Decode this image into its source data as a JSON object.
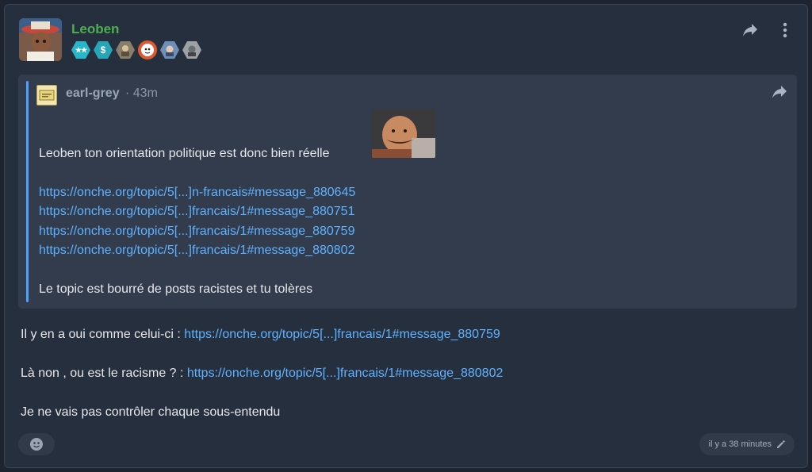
{
  "post": {
    "author": "Leoben",
    "author_color": "#4caf50",
    "badges": [
      {
        "name": "stars-badge",
        "symbol": "★★",
        "color": "#29b6c9"
      },
      {
        "name": "dollar-badge",
        "symbol": "$",
        "color": "#26a6b8"
      },
      {
        "name": "avatar-badge-1",
        "symbol": "",
        "color": "#8a7f6a"
      },
      {
        "name": "avatar-badge-2",
        "symbol": "",
        "color": "#e0582f"
      },
      {
        "name": "avatar-badge-3",
        "symbol": "",
        "color": "#6d8fb8"
      },
      {
        "name": "avatar-badge-4",
        "symbol": "",
        "color": "#9ea1a6"
      }
    ],
    "quote": {
      "author": "earl-grey",
      "separator": "·",
      "time": "43m",
      "text": "Leoben ton orientation politique est donc bien réelle",
      "links": [
        "https://onche.org/topic/5[...]n-francais#message_880645",
        "https://onche.org/topic/5[...]francais/1#message_880751",
        "https://onche.org/topic/5[...]francais/1#message_880759",
        "https://onche.org/topic/5[...]francais/1#message_880802"
      ],
      "footer": "Le topic est bourré de posts racistes et tu tolères"
    },
    "body": {
      "line1_text": "Il y en a oui comme celui-ci : ",
      "line1_link": "https://onche.org/topic/5[...]francais/1#message_880759",
      "line2_text": "Là non , ou est le racisme ? : ",
      "line2_link": "https://onche.org/topic/5[...]francais/1#message_880802",
      "line3_text": "Je ne vais pas contrôler chaque sous-entendu"
    },
    "timestamp": "il y a 38 minutes",
    "accent_link_color": "#5fb2ff"
  }
}
